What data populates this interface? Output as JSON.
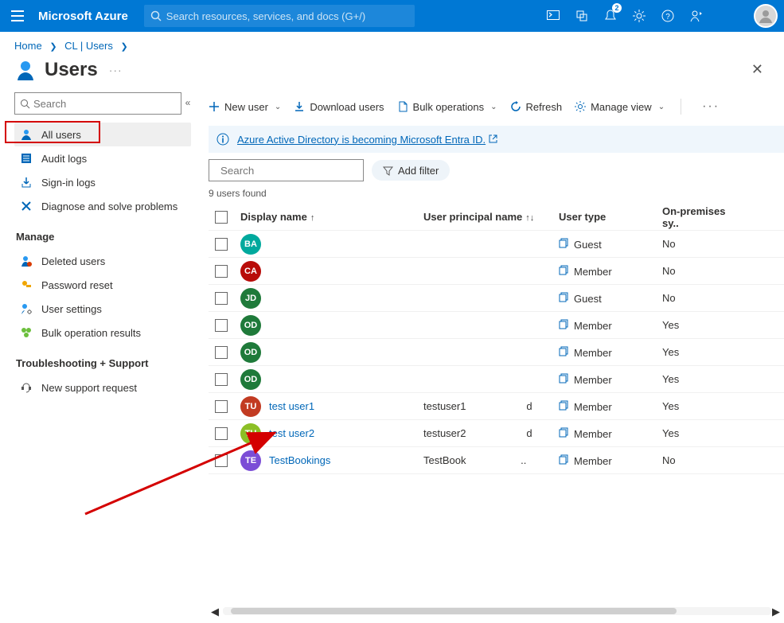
{
  "topbar": {
    "brand": "Microsoft Azure",
    "search_placeholder": "Search resources, services, and docs (G+/)",
    "account_label": "",
    "notification_badge": "2"
  },
  "breadcrumbs": {
    "home": "Home",
    "mid": "CL | Users"
  },
  "page": {
    "title": "Users"
  },
  "sidebar": {
    "search_placeholder": "Search",
    "items": [
      {
        "label": "All users"
      },
      {
        "label": "Audit logs"
      },
      {
        "label": "Sign-in logs"
      },
      {
        "label": "Diagnose and solve problems"
      }
    ],
    "manage_header": "Manage",
    "manage": [
      {
        "label": "Deleted users"
      },
      {
        "label": "Password reset"
      },
      {
        "label": "User settings"
      },
      {
        "label": "Bulk operation results"
      }
    ],
    "ts_header": "Troubleshooting + Support",
    "ts": [
      {
        "label": "New support request"
      }
    ]
  },
  "toolbar": {
    "new_user": "New user",
    "download": "Download users",
    "bulk": "Bulk operations",
    "refresh": "Refresh",
    "manage_view": "Manage view"
  },
  "infobar": {
    "text": "Azure Active Directory is becoming Microsoft Entra ID."
  },
  "filter": {
    "search_placeholder": "Search",
    "add_filter": "Add filter"
  },
  "table": {
    "result_count": "9 users found",
    "headers": {
      "display": "Display name",
      "upn": "User principal name",
      "type": "User type",
      "onprem": "On-premises sy.."
    },
    "rows": [
      {
        "initials": "BA",
        "color": "#00a99d",
        "name": "",
        "upn": "",
        "type": "Guest",
        "onprem": "No",
        "link": false
      },
      {
        "initials": "CA",
        "color": "#b80c09",
        "name": "",
        "upn": "",
        "type": "Member",
        "onprem": "No",
        "link": false
      },
      {
        "initials": "JD",
        "color": "#1f7a3a",
        "name": "",
        "upn": "",
        "type": "Guest",
        "onprem": "No",
        "link": false
      },
      {
        "initials": "OD",
        "color": "#1f7a3a",
        "name": "",
        "upn": "",
        "type": "Member",
        "onprem": "Yes",
        "link": false
      },
      {
        "initials": "OD",
        "color": "#1f7a3a",
        "name": "",
        "upn": "",
        "type": "Member",
        "onprem": "Yes",
        "link": false
      },
      {
        "initials": "OD",
        "color": "#1f7a3a",
        "name": "",
        "upn": "",
        "type": "Member",
        "onprem": "Yes",
        "link": false
      },
      {
        "initials": "TU",
        "color": "#c23b22",
        "name": "test user1",
        "upn": "testuser1                     d",
        "type": "Member",
        "onprem": "Yes",
        "link": true
      },
      {
        "initials": "TU",
        "color": "#8cbf26",
        "name": "test user2",
        "upn": "testuser2                     d",
        "type": "Member",
        "onprem": "Yes",
        "link": true
      },
      {
        "initials": "TE",
        "color": "#7b4dd6",
        "name": "TestBookings",
        "upn": "TestBook                   ..",
        "type": "Member",
        "onprem": "No",
        "link": true
      }
    ]
  }
}
